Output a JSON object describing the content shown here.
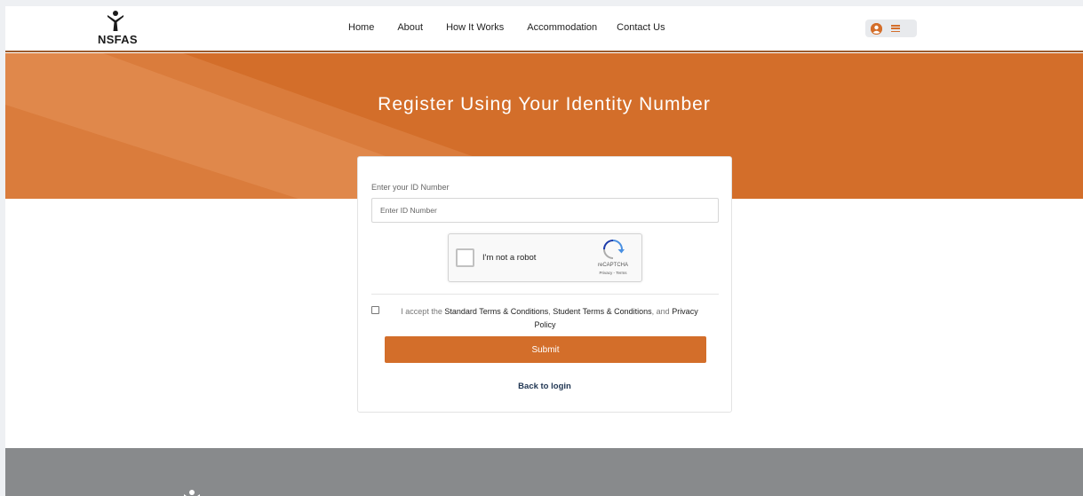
{
  "header": {
    "logo_text": "NSFAS",
    "nav": [
      "Home",
      "About",
      "How It Works",
      "Accommodation",
      "Contact Us"
    ]
  },
  "hero": {
    "title": "Register Using Your Identity Number"
  },
  "form": {
    "id_label": "Enter your ID Number",
    "id_placeholder": "Enter ID Number",
    "id_value": "",
    "captcha": {
      "label": "I'm not a robot",
      "brand": "reCAPTCHA",
      "links": "Privacy - Terms",
      "checked": false
    },
    "terms": {
      "checked": false,
      "prefix": "I accept the ",
      "link1": "Standard Terms & Conditions",
      "sep1": ", ",
      "link2": "Student Terms & Conditions",
      "sep2": ", and ",
      "link3a": "Privacy",
      "link3b": "Policy"
    },
    "submit_label": "Submit",
    "back_label": "Back to login"
  },
  "colors": {
    "brand_orange": "#d36e2a",
    "footer_gray": "#888a8c",
    "link_navy": "#1f3552"
  }
}
